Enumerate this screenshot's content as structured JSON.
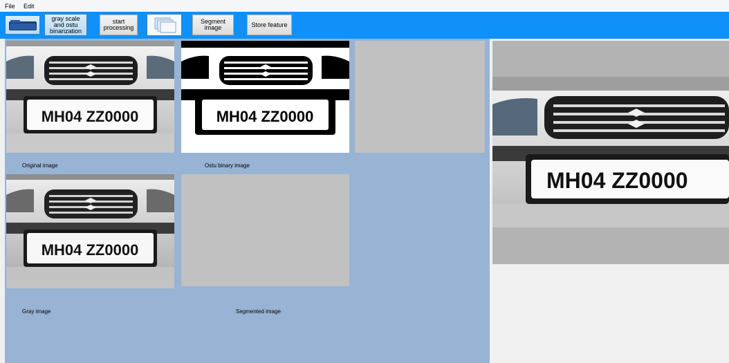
{
  "menu": {
    "file": "File",
    "edit": "Edit"
  },
  "toolbar": {
    "open_icon": "folder-open-icon",
    "grayscale_button": "gray scale\nand ostu\nbinarization",
    "start_button": "start\nprocessing",
    "docs_icon": "documents-icon",
    "segment_button": "Segment\nimage",
    "store_button": "Store feature"
  },
  "images": {
    "plate_text": "MH04 ZZ0000",
    "original_label": "Original image",
    "ostu_label": "Ostu binary image",
    "gray_label": "Gray image",
    "segmented_label": "Segmented image"
  }
}
